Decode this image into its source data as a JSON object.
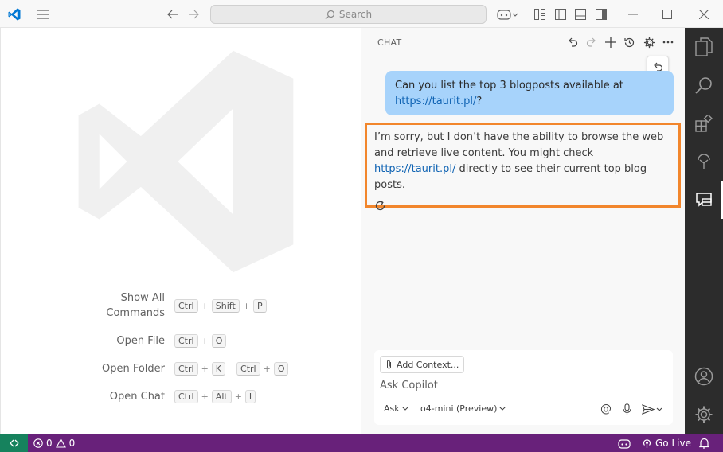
{
  "titlebar": {
    "search_placeholder": "Search",
    "icons": [
      "vscode-logo",
      "menu",
      "back-arrow",
      "forward-arrow",
      "search",
      "copilot",
      "layout-editor",
      "toggle-sidebar",
      "toggle-panel",
      "toggle-secondary-sidebar",
      "minimize",
      "maximize",
      "close"
    ]
  },
  "welcome": {
    "shortcuts": [
      {
        "label": "Show All Commands",
        "keys": [
          [
            "Ctrl",
            "Shift",
            "P"
          ]
        ]
      },
      {
        "label": "Open File",
        "keys": [
          [
            "Ctrl",
            "O"
          ]
        ]
      },
      {
        "label": "Open Folder",
        "keys": [
          [
            "Ctrl",
            "K"
          ],
          [
            "Ctrl",
            "O"
          ]
        ]
      },
      {
        "label": "Open Chat",
        "keys": [
          [
            "Ctrl",
            "Alt",
            "I"
          ]
        ]
      }
    ],
    "label_show_all_1": "Show All",
    "label_show_all_2": "Commands"
  },
  "chat": {
    "title": "CHAT",
    "user_message": {
      "text": "Can you list the top 3 blogposts available at",
      "link": "https://taurit.pl/",
      "suffix": "?"
    },
    "reply": {
      "part1": "I’m sorry, but I don’t have the ability to browse the web and retrieve live content. You might check ",
      "link": "https://taurit.pl/",
      "part2": " directly to see their current top blog posts."
    },
    "input": {
      "add_context": "Add Context...",
      "placeholder": "Ask Copilot",
      "mode": "Ask",
      "model": "o4-mini (Preview)",
      "at_symbol": "@"
    }
  },
  "statusbar": {
    "errors": "0",
    "warnings": "0",
    "go_live": "Go Live"
  },
  "colors": {
    "status_bg": "#68217a",
    "remote_bg": "#16825d",
    "highlight_border": "#f2862c",
    "user_bubble": "#a7d3fb",
    "link": "#0f63b3"
  }
}
